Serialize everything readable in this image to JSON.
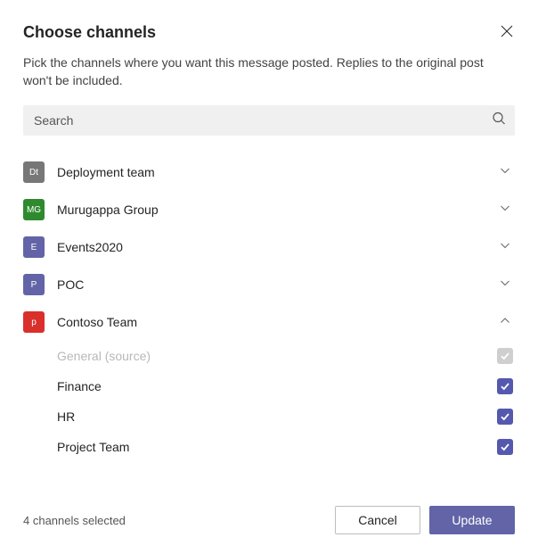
{
  "header": {
    "title": "Choose channels"
  },
  "description": "Pick the channels where you want this message posted. Replies to the original post won't be included.",
  "search": {
    "placeholder": "Search"
  },
  "teams": [
    {
      "id": "deployment",
      "name": "Deployment team",
      "initials": "Dt",
      "color": "#777777",
      "expanded": false
    },
    {
      "id": "murugappa",
      "name": "Murugappa Group",
      "initials": "MG",
      "color": "#2f8a2f",
      "expanded": false
    },
    {
      "id": "events",
      "name": "Events2020",
      "initials": "E",
      "color": "#6264a7",
      "expanded": false
    },
    {
      "id": "poc",
      "name": "POC",
      "initials": "P",
      "color": "#6264a7",
      "expanded": false
    },
    {
      "id": "contoso",
      "name": "Contoso Team",
      "initials": "p",
      "color": "#d9302c",
      "expanded": true
    }
  ],
  "channels": {
    "contoso": [
      {
        "name": "General (source)",
        "checked": true,
        "disabled": true
      },
      {
        "name": "Finance",
        "checked": true,
        "disabled": false
      },
      {
        "name": "HR",
        "checked": true,
        "disabled": false
      },
      {
        "name": "Project Team",
        "checked": true,
        "disabled": false
      }
    ]
  },
  "footer": {
    "status": "4 channels selected",
    "cancel_label": "Cancel",
    "update_label": "Update"
  }
}
